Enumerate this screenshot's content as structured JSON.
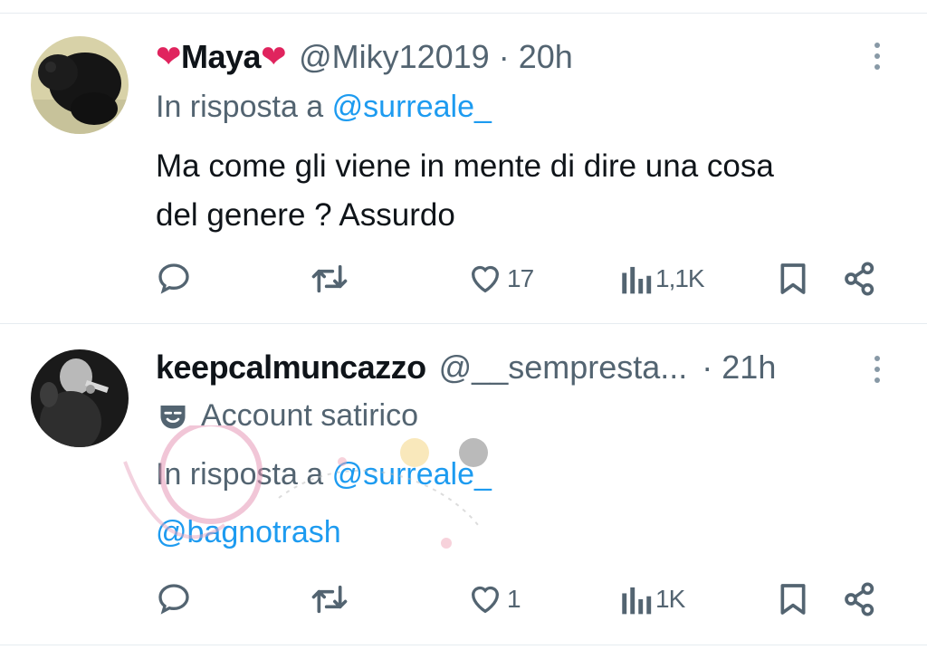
{
  "tweets": [
    {
      "display_name": "Maya",
      "handle": "@Miky12019",
      "time": "· 20h",
      "reply_prefix": "In risposta a",
      "reply_to": "@surreale_",
      "text_line1": "Ma come gli viene in mente di dire una cosa",
      "text_line2": "del genere ? Assurdo",
      "likes": "17",
      "views": "1,1K"
    },
    {
      "display_name": "keepcalmuncazzo",
      "handle": "@__sempresta...",
      "time": "· 21h",
      "label": "Account satirico",
      "reply_prefix": "In risposta a",
      "reply_to": "@surreale_",
      "mention": "@bagnotrash",
      "likes": "1",
      "views": "1K"
    }
  ],
  "colors": {
    "text": "#0f1419",
    "secondary": "#536471",
    "link": "#1d9bf0",
    "heart": "#e0245e",
    "divider": "#e6ecf0"
  },
  "icons": [
    "heart-emoji-icon",
    "more-icon",
    "reply-icon",
    "retweet-icon",
    "like-icon",
    "views-icon",
    "bookmark-icon",
    "share-icon",
    "satire-mask-icon"
  ]
}
